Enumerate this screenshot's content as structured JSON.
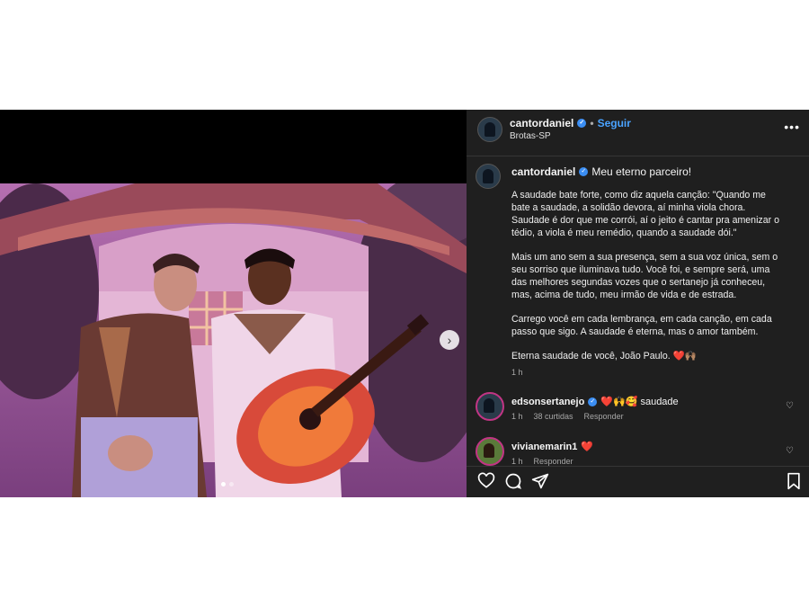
{
  "header": {
    "username": "cantordaniel",
    "follow_label": "Seguir",
    "separator": "•",
    "location": "Brotas-SP",
    "more_label": "•••"
  },
  "caption": {
    "username": "cantordaniel",
    "title": "Meu eterno parceiro!",
    "paragraphs": [
      "A saudade bate forte, como diz aquela canção: \"Quando me bate a saudade, a solidão devora, aí minha viola chora. Saudade é dor que me corrói, aí o jeito é cantar pra amenizar o tédio, a viola é meu remédio, quando a saudade dói.\"",
      "Mais um ano sem a sua presença, sem a sua voz única, sem o seu sorriso que iluminava tudo. Você foi, e sempre será, uma das melhores segundas vozes que o sertanejo já conheceu, mas, acima de tudo, meu irmão de vida e de estrada.",
      "Carrego você em cada lembrança, em cada canção, em cada passo que sigo. A saudade é eterna, mas o amor também.",
      "Eterna saudade de você, João Paulo. ❤️🙌🏽"
    ],
    "time": "1 h"
  },
  "comments": [
    {
      "username": "edsonsertanejo",
      "text": "❤️🙌🥰 saudade",
      "time": "1 h",
      "likes": "38 curtidas",
      "reply_label": "Responder"
    },
    {
      "username": "vivianemarin1",
      "text": "❤️",
      "time": "1 h",
      "reply_label": "Responder"
    }
  ],
  "media": {
    "next_icon": "chevron-right-icon",
    "slide_count": 2,
    "active_slide": 1
  },
  "colors": {
    "panel_bg": "#1f1f1f",
    "link_blue": "#4aa3ff",
    "verified_blue": "#3b8ef3",
    "heart_red": "#ff3040"
  }
}
